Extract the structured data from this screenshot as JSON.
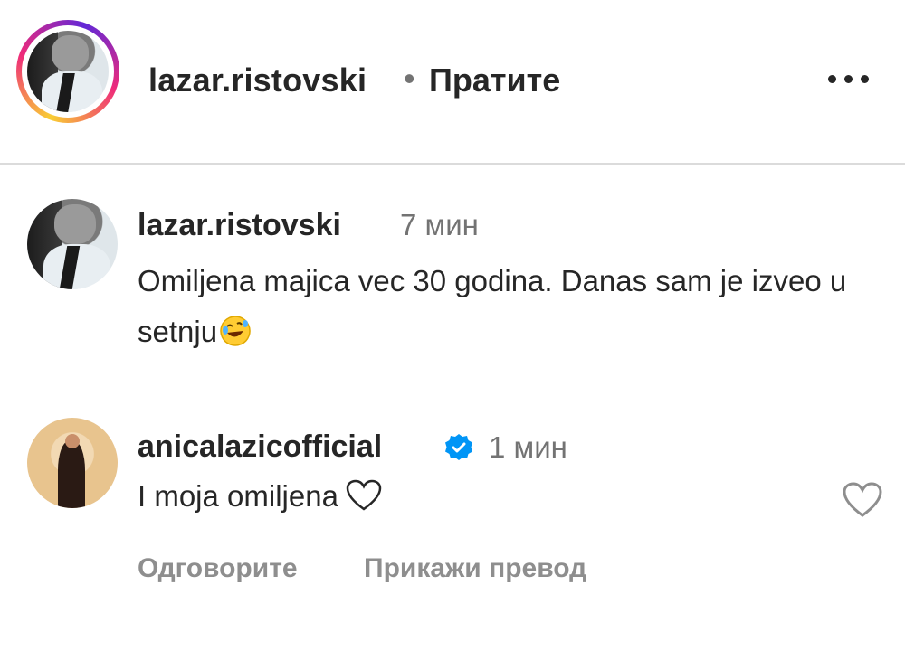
{
  "header": {
    "username": "lazar.ristovski",
    "separator": "•",
    "follow_label": "Пратите",
    "more_icon": "more-horizontal-icon"
  },
  "caption": {
    "username": "lazar.ristovski",
    "time": "7 мин",
    "text": "Omiljena majica vec 30 godina. Danas sam je izveo u setnju",
    "emoji": "rolling-on-floor-laughing-emoji"
  },
  "comment": {
    "username": "anicalazicofficial",
    "verified_icon": "verified-badge-icon",
    "time": "1 мин",
    "text": "I moja omiljena",
    "inline_icon": "heart-outline-icon",
    "reply_label": "Одговорите",
    "translate_label": "Прикажи превод"
  },
  "colors": {
    "primary_text": "#262626",
    "secondary_text": "#737373",
    "verified": "#0095f6",
    "divider": "#dbdbdb"
  }
}
